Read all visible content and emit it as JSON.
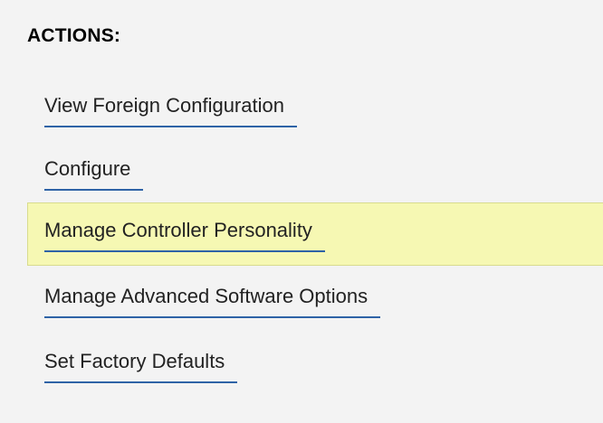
{
  "actions_panel": {
    "heading": "ACTIONS:",
    "items": [
      {
        "label": "View Foreign Configuration",
        "highlighted": false
      },
      {
        "label": "Configure",
        "highlighted": false
      },
      {
        "label": "Manage Controller Personality",
        "highlighted": true
      },
      {
        "label": "Manage Advanced Software Options",
        "highlighted": false
      },
      {
        "label": "Set Factory Defaults",
        "highlighted": false
      }
    ],
    "colors": {
      "panel_background": "#f3f3f3",
      "highlight_background": "#f6f8b3",
      "link_underline": "#2e63a6",
      "link_text": "#222222"
    }
  }
}
